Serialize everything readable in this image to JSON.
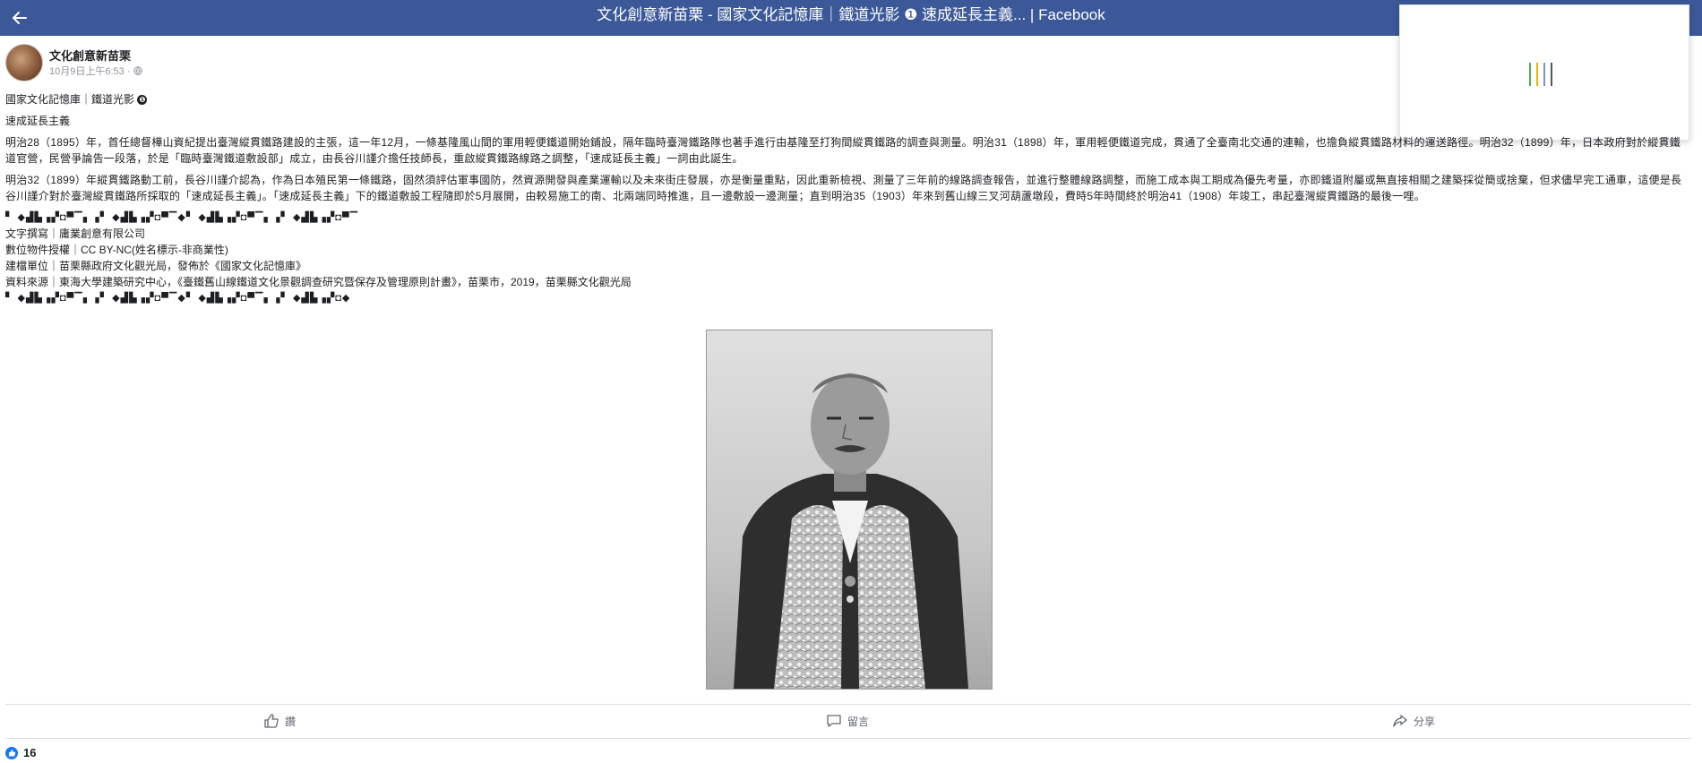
{
  "window": {
    "title": "文化創意新苗栗 - 國家文化記憶庫｜鐵道光影 ❶ 速成延長主義... | Facebook"
  },
  "post": {
    "page_name": "文化創意新苗栗",
    "timestamp": "10月9日上午6:53",
    "privacy_separator": "·",
    "headline": "國家文化記憶庫｜鐵道光影",
    "headline_badge": "❶",
    "subtitle": "速成延長主義",
    "paragraph_1": "明治28（1895）年，首任總督樺山資紀提出臺灣縱貫鐵路建設的主張，這一年12月，一條基隆風山間的軍用輕便鐵道開始鋪設，隔年臨時臺灣鐵路隊也著手進行由基隆至打狗間縱貫鐵路的調查與測量。明治31（1898）年，軍用輕便鐵道完成，貫通了全臺南北交通的連輸，也擔負縱貫鐵路材料的運送路徑。明治32（1899）年，日本政府對於縱貫鐵道官營，民營爭論告一段落，於是「臨時臺灣鐵道敷設部」成立，由長谷川謹介擔任技師長，重啟縱貫鐵路線路之調整，「速成延長主義」一詞由此誕生。",
    "paragraph_2": "明治32（1899）年縱貫鐵路動工前，長谷川謹介認為，作為日本殖民第一條鐵路，固然須評估軍事國防，然資源開發與產業運輸以及未來街庄發展，亦是衡量重點，因此重新檢視、測量了三年前的線路調查報告，並進行整體線路調整，而施工成本與工期成為優先考量，亦即鐵道附屬或無直接相關之建築採從簡或捨棄，但求儘早完工通車，這便是長谷川謹介對於臺灣縱貫鐵路所採取的「速成延長主義」。「速成延長主義」下的鐵道敷設工程隨即於5月展開，由較易施工的南、北兩端同時推進，且一邊敷設一邊測量；直到明治35（1903）年來到舊山線三叉河葫蘆墩段，費時5年時間終於明治41（1908）年竣工，串起臺灣縱貫鐵路的最後一哩。",
    "deco_line_1": "▘ ◆▟▙▗▞◘▀▔▖▗▘ ◆▟▙▗▞◘▀▔◆▘ ◆▟▙▗▞◘▀▔▖▗▘ ◆▟▙▗▞◘▀▔",
    "credit_1": "文字撰寫｜庸業創意有限公司",
    "credit_2": "數位物件授權｜CC BY-NC(姓名標示-非商業性)",
    "credit_3": "建檔單位｜苗栗縣政府文化觀光局，發佈於《國家文化記憶庫》",
    "credit_4": "資料來源｜東海大學建築研究中心，《臺鐵舊山線鐵道文化景觀調查研究暨保存及管理原則計畫》，苗栗市，2019，苗栗縣文化觀光局",
    "deco_line_2": "▘ ◆▟▙▗▞◘▀▔▖▗▘ ◆▟▙▗▞◘▀▔◆▘ ◆▟▙▗▞◘▀▔▖▗▘ ◆▟▙▗▞◘◆"
  },
  "actions": {
    "like_label": "讚",
    "comment_label": "留言",
    "share_label": "分享"
  },
  "reactions": {
    "count": "16"
  },
  "colors": {
    "brand_blue": "#3b5998",
    "like_blue": "#1877f2",
    "loader_bars": [
      "#4caf50",
      "#f4b400",
      "#7b8fd1",
      "#555555"
    ]
  },
  "icons": {
    "back": "back-arrow-icon",
    "privacy": "globe-icon",
    "like": "thumbs-up-icon",
    "comment": "speech-bubble-icon",
    "share": "share-arrow-icon"
  }
}
